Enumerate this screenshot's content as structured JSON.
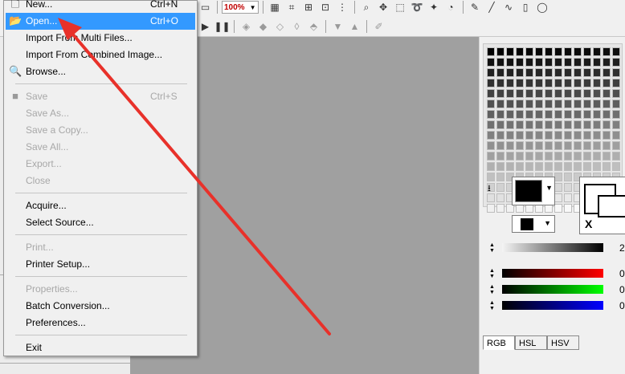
{
  "file_menu": {
    "items": [
      {
        "label": "New...",
        "shortcut": "Ctrl+N",
        "enabled": true
      },
      {
        "label": "Open...",
        "shortcut": "Ctrl+O",
        "enabled": true,
        "highlighted": true,
        "icon": "folder-open-icon"
      },
      {
        "label": "Import From Multi Files...",
        "enabled": true
      },
      {
        "label": "Import From Combined Image...",
        "enabled": true
      },
      {
        "label": "Browse...",
        "enabled": true,
        "icon": "magnifier-icon"
      },
      {
        "label": "Save",
        "shortcut": "Ctrl+S",
        "enabled": false,
        "icon": "save-icon"
      },
      {
        "label": "Save As...",
        "enabled": false
      },
      {
        "label": "Save a Copy...",
        "enabled": false
      },
      {
        "label": "Save All...",
        "enabled": false
      },
      {
        "label": "Export...",
        "enabled": false
      },
      {
        "label": "Close",
        "enabled": false
      },
      {
        "label": "Acquire...",
        "enabled": true
      },
      {
        "label": "Select Source...",
        "enabled": true
      },
      {
        "label": "Print...",
        "enabled": false
      },
      {
        "label": "Printer Setup...",
        "enabled": true
      },
      {
        "label": "Properties...",
        "enabled": false
      },
      {
        "label": "Batch Conversion...",
        "enabled": true
      },
      {
        "label": "Preferences...",
        "enabled": true
      },
      {
        "label": "Exit",
        "enabled": true
      }
    ]
  },
  "toolbar": {
    "zoom_value": "100%"
  },
  "color_panel": {
    "foreground_color": "#000000",
    "background_color": "#000000",
    "gray_value_visible": "2",
    "channel_values": [
      "0",
      "0",
      "0"
    ],
    "channel_colors": [
      "#ff0000",
      "#00ff00",
      "#0000ff"
    ],
    "preview_label": "X",
    "tabs": [
      "RGB",
      "HSL",
      "HSV"
    ],
    "active_tab": "RGB"
  },
  "annotation": {
    "arrow_color": "#e8312a"
  }
}
